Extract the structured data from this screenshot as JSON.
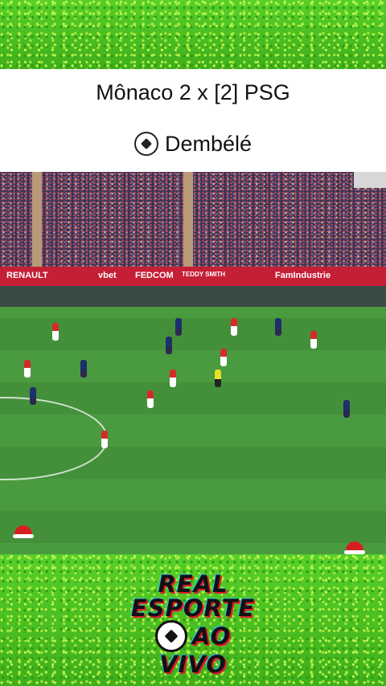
{
  "header": {
    "score_line": "Mônaco 2 x [2] PSG",
    "scorer": "Dembélé",
    "scorer_icon": "soccer-ball-icon"
  },
  "video": {
    "ad_boards": [
      "RENAULT",
      "vbet",
      "FEDCOM",
      "TEDDY SMITH",
      "FamIndustrie"
    ]
  },
  "logo": {
    "line1": "REAL",
    "line2": "ESPORTE",
    "line3": "AO",
    "line4": "VIVO"
  },
  "colors": {
    "confetti_green": "#46b81f",
    "monaco_red": "#d62a2a",
    "psg_navy": "#1e2f6b",
    "ad_board_red": "#c51f35"
  }
}
